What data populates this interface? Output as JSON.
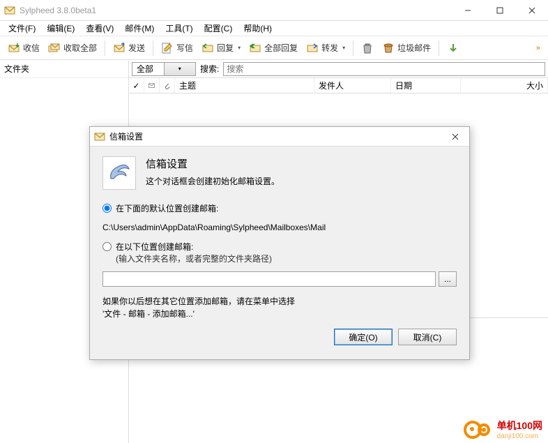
{
  "window": {
    "title": "Sylpheed 3.8.0beta1"
  },
  "menu": {
    "file": "文件(F)",
    "edit": "编辑(E)",
    "view": "查看(V)",
    "mail": "邮件(M)",
    "tools": "工具(T)",
    "config": "配置(C)",
    "help": "帮助(H)"
  },
  "toolbar": {
    "receive": "收信",
    "receive_all": "收取全部",
    "send": "发送",
    "compose": "写信",
    "reply": "回复",
    "reply_all": "全部回复",
    "forward": "转发",
    "junk": "垃圾邮件"
  },
  "sidebar": {
    "title": "文件夹"
  },
  "filter": {
    "combo_value": "全部",
    "search_label": "搜索:",
    "search_placeholder": "搜索"
  },
  "columns": {
    "mark": "✓",
    "subject": "主题",
    "from": "发件人",
    "date": "日期",
    "size": "大小"
  },
  "dialog": {
    "title": "信箱设置",
    "heading": "信箱设置",
    "subtitle": "这个对话框会创建初始化邮箱设置。",
    "radio_default": "在下面的默认位置创建邮箱:",
    "default_path": "C:\\Users\\admin\\AppData\\Roaming\\Sylpheed\\Mailboxes\\Mail",
    "radio_custom": "在以下位置创建邮箱:",
    "radio_custom_hint": "(输入文件夹名称，或者完整的文件夹路径)",
    "browse": "...",
    "note_line1": "如果你以后想在其它位置添加邮箱，请在菜单中选择",
    "note_line2": "'文件 - 邮箱 - 添加邮箱...'",
    "ok": "确定(O)",
    "cancel": "取消(C)"
  },
  "brand": {
    "name": "单机100网",
    "url": "danji100.com"
  }
}
